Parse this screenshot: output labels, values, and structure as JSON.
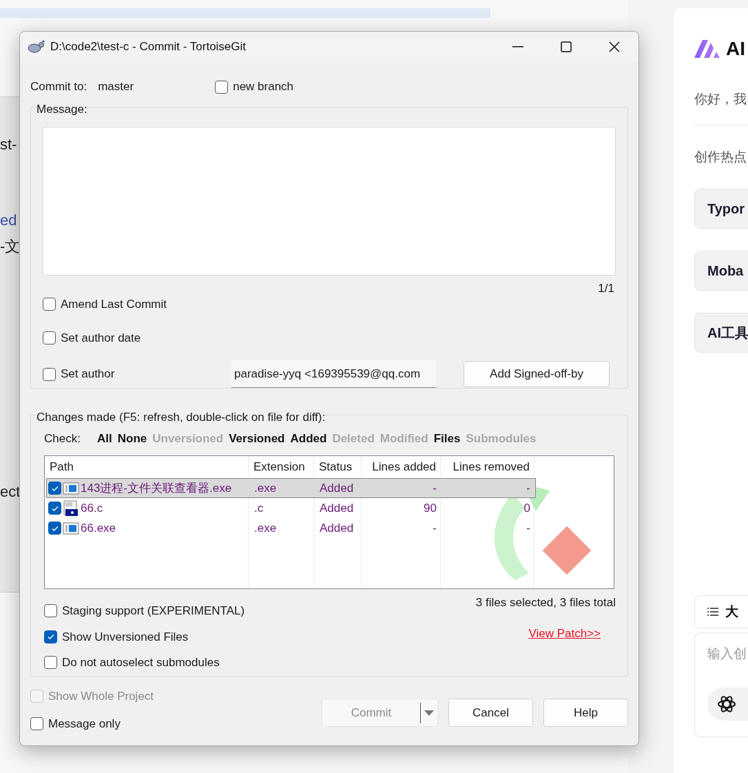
{
  "background_window": {
    "fragments": [
      {
        "text": "st-",
        "kind": "plain"
      },
      {
        "text": "ed",
        "kind": "link"
      },
      {
        "text": "-文",
        "kind": "plain"
      },
      {
        "text": "ect",
        "kind": "plain"
      }
    ]
  },
  "dialog": {
    "title": "D:\\code2\\test-c - Commit - TortoiseGit",
    "commit_to": {
      "label": "Commit to:",
      "branch": "master"
    },
    "new_branch": {
      "label": "new branch",
      "checked": false
    },
    "message": {
      "label": "Message:",
      "counter": "1/1"
    },
    "options": [
      {
        "label": "Amend Last Commit",
        "checked": false
      },
      {
        "label": "Set author date",
        "checked": false
      },
      {
        "label": "Set author",
        "checked": false
      }
    ],
    "author": {
      "value": "paradise-yyq <169395539@qq.com"
    },
    "signed_off_button": "Add Signed-off-by",
    "changes": {
      "label": "Changes made (F5: refresh, double-click on file for diff):",
      "check_label": "Check:",
      "filters": [
        {
          "label": "All",
          "enabled": true
        },
        {
          "label": "None",
          "enabled": true
        },
        {
          "label": "Unversioned",
          "enabled": false
        },
        {
          "label": "Versioned",
          "enabled": true
        },
        {
          "label": "Added",
          "enabled": true
        },
        {
          "label": "Deleted",
          "enabled": false
        },
        {
          "label": "Modified",
          "enabled": false
        },
        {
          "label": "Files",
          "enabled": true
        },
        {
          "label": "Submodules",
          "enabled": false
        }
      ],
      "columns": [
        "Path",
        "Extension",
        "Status",
        "Lines added",
        "Lines removed"
      ],
      "rows": [
        {
          "path": "143进程-文件关联查看器.exe",
          "kind": "exe",
          "extension": ".exe",
          "status": "Added",
          "lines_added": "-",
          "lines_removed": "-",
          "checked": true,
          "selected": true
        },
        {
          "path": "66.c",
          "kind": "c",
          "extension": ".c",
          "status": "Added",
          "lines_added": "90",
          "lines_removed": "0",
          "checked": true,
          "selected": false
        },
        {
          "path": "66.exe",
          "kind": "exe",
          "extension": ".exe",
          "status": "Added",
          "lines_added": "-",
          "lines_removed": "-",
          "checked": true,
          "selected": false
        }
      ],
      "summary": "3 files selected, 3 files total",
      "view_patch": "View Patch>>",
      "options": [
        {
          "label": "Staging support (EXPERIMENTAL)",
          "checked": false
        },
        {
          "label": "Show Unversioned Files",
          "checked": true
        },
        {
          "label": "Do not autoselect submodules",
          "checked": false
        }
      ]
    },
    "bottom_options": [
      {
        "label": "Show Whole Project",
        "checked": false,
        "disabled": true
      },
      {
        "label": "Message only",
        "checked": false,
        "disabled": false
      }
    ],
    "buttons": [
      {
        "label": "Commit",
        "disabled": true,
        "kind": "split"
      },
      {
        "label": "Cancel",
        "disabled": false,
        "kind": "plain"
      },
      {
        "label": "Help",
        "disabled": false,
        "kind": "plain"
      }
    ]
  },
  "side_panel": {
    "title": "AI",
    "greeting": "你好，我",
    "section": "创作热点",
    "cards": [
      "Typor",
      "Moba",
      "AI工具"
    ],
    "outline": "大",
    "input_placeholder": "输入创"
  }
}
